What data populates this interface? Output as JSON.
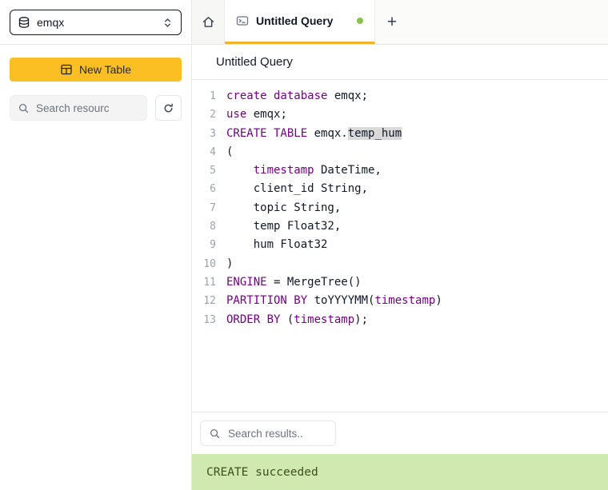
{
  "sidebar": {
    "database_select": {
      "value": "emqx"
    },
    "new_table_button": {
      "label": "New Table"
    },
    "search": {
      "placeholder": "Search resourc"
    }
  },
  "tabbar": {
    "active_tab": {
      "label": "Untitled Query"
    },
    "new_tab_label": "+"
  },
  "query_panel": {
    "title": "Untitled Query"
  },
  "editor": {
    "lines": [
      [
        {
          "t": "create database",
          "c": "kw"
        },
        {
          "t": " emqx;",
          "c": "plain"
        }
      ],
      [
        {
          "t": "use",
          "c": "kw"
        },
        {
          "t": " emqx;",
          "c": "plain"
        }
      ],
      [
        {
          "t": "CREATE TABLE",
          "c": "kw"
        },
        {
          "t": " emqx.",
          "c": "plain"
        },
        {
          "t": "temp_hum",
          "c": "sel"
        }
      ],
      [
        {
          "t": "(",
          "c": "plain"
        }
      ],
      [
        {
          "t": "    ",
          "c": "plain"
        },
        {
          "t": "timestamp",
          "c": "kw"
        },
        {
          "t": " DateTime,",
          "c": "plain"
        }
      ],
      [
        {
          "t": "    client_id String,",
          "c": "plain"
        }
      ],
      [
        {
          "t": "    topic String,",
          "c": "plain"
        }
      ],
      [
        {
          "t": "    temp Float32,",
          "c": "plain"
        }
      ],
      [
        {
          "t": "    hum Float32",
          "c": "plain"
        }
      ],
      [
        {
          "t": ")",
          "c": "plain"
        }
      ],
      [
        {
          "t": "ENGINE",
          "c": "kw"
        },
        {
          "t": " = MergeTree()",
          "c": "plain"
        }
      ],
      [
        {
          "t": "PARTITION BY",
          "c": "kw"
        },
        {
          "t": " toYYYYMM(",
          "c": "plain"
        },
        {
          "t": "timestamp",
          "c": "kw"
        },
        {
          "t": ")",
          "c": "plain"
        }
      ],
      [
        {
          "t": "ORDER BY",
          "c": "kw"
        },
        {
          "t": " (",
          "c": "plain"
        },
        {
          "t": "timestamp",
          "c": "kw"
        },
        {
          "t": ");",
          "c": "plain"
        }
      ]
    ]
  },
  "results": {
    "search_placeholder": "Search results.."
  },
  "status": {
    "message": "CREATE succeeded"
  },
  "icons": {
    "database": "database-icon",
    "select_chevrons": "chevron-up-down-icon",
    "new_table": "table-grid-icon",
    "sidebar_search": "search-icon",
    "refresh": "refresh-icon",
    "home": "home-icon",
    "tab": "console-icon",
    "tab_status": "green-dot",
    "new_tab": "plus-icon",
    "results_search": "search-icon"
  },
  "colors": {
    "accent_yellow": "#fbbf24",
    "tab_underline": "#f0b429",
    "keyword_purple": "#770088",
    "selection_gray": "#d9d9d9",
    "success_bg": "#cfe9b0",
    "success_text": "#3f4f21",
    "green_dot": "#8bc34a",
    "line_number_gray": "#9ca3af",
    "border_gray": "#e5e7eb"
  }
}
